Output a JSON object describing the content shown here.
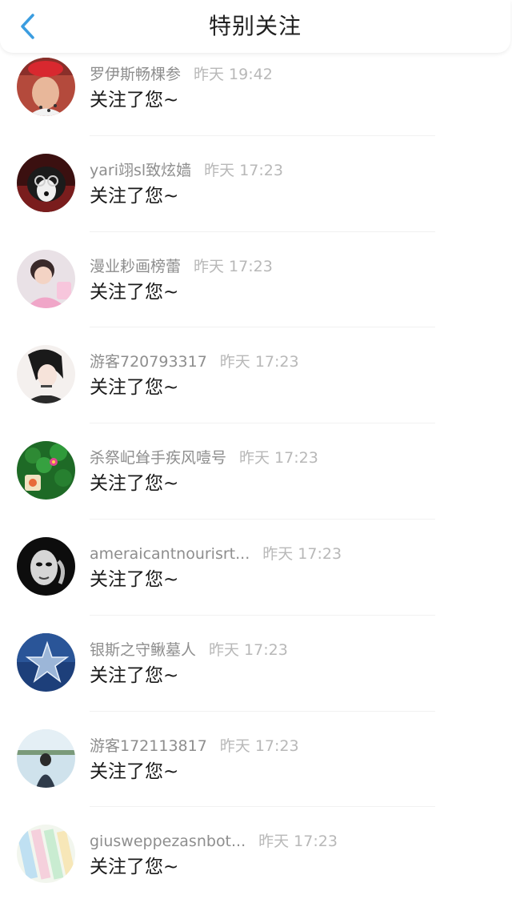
{
  "header": {
    "title": "特别关注",
    "back_icon": "chevron-left-icon",
    "accent_color": "#3b9de0"
  },
  "notifications": [
    {
      "name": "罗伊斯畅棵参",
      "time": "昨天 19:42",
      "message": "关注了您~"
    },
    {
      "name": "yari翊sl致炫嫱",
      "time": "昨天 17:23",
      "message": "关注了您~"
    },
    {
      "name": "漫业耖画榜蕾",
      "time": "昨天 17:23",
      "message": "关注了您~"
    },
    {
      "name": "游客720793317",
      "time": "昨天 17:23",
      "message": "关注了您~"
    },
    {
      "name": "杀祭屺耸手疾风噎号",
      "time": "昨天 17:23",
      "message": "关注了您~"
    },
    {
      "name": "ameraicantnourisrt...",
      "time": "昨天 17:23",
      "message": "关注了您~"
    },
    {
      "name": "银斯之守鳅墓人",
      "time": "昨天 17:23",
      "message": "关注了您~"
    },
    {
      "name": "游客172113817",
      "time": "昨天 17:23",
      "message": "关注了您~"
    },
    {
      "name": "giusweppezasnbot...",
      "time": "昨天 17:23",
      "message": "关注了您~"
    }
  ]
}
